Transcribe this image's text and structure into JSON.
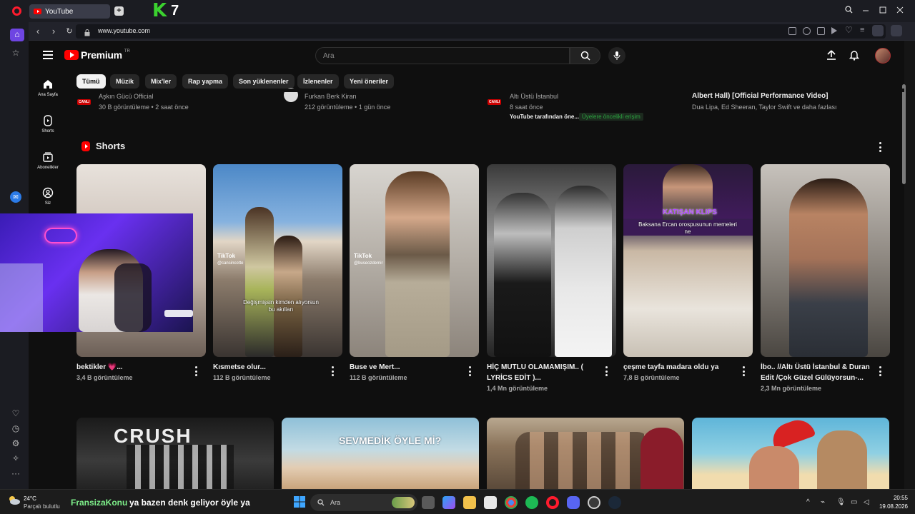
{
  "browser": {
    "tab_title": "YouTube",
    "new_tab": "+",
    "overlay_k": "K",
    "overlay_7": "7",
    "url": "www.youtube.com"
  },
  "youtube": {
    "logo_text": "Premium",
    "logo_region": "TR",
    "search_placeholder": "Ara",
    "chips": [
      "Tümü",
      "Müzik",
      "Mix'ler",
      "Rap yapma",
      "Son yüklenenler",
      "İzlenenler",
      "Yeni öneriler"
    ],
    "guide": [
      {
        "label": "Ana Sayfa",
        "icon": "home-icon"
      },
      {
        "label": "Shorts",
        "icon": "shorts-icon"
      },
      {
        "label": "Abonelikler",
        "icon": "subscriptions-icon"
      },
      {
        "label": "Siz",
        "icon": "you-icon"
      }
    ],
    "top_row": [
      {
        "channel": "Aşkın Gücü Official",
        "meta": "30 B görüntüleme • 2 saat önce",
        "live_badge": "CANLI"
      },
      {
        "channel": "Furkan Berk Kiran",
        "meta": "212 görüntüleme • 1 gün önce"
      },
      {
        "channel": "Altı Üstü İstanbul",
        "meta": "8 saat önce",
        "extra": "YouTube tarafından öne...",
        "badge": "Üyelere öncelikli erişim",
        "live_badge": "CANLI"
      },
      {
        "title": "Albert Hall) [Official Performance Video]",
        "meta": "Dua Lipa, Ed Sheeran, Taylor Swift ve daha fazlası"
      }
    ],
    "shorts_title": "Shorts",
    "shorts": [
      {
        "title": "bektikler 💗...",
        "views": "3,4 B görüntüleme"
      },
      {
        "title": "Kısmetse olur...",
        "views": "112 B görüntüleme",
        "caption": "Değişmişsin kimden alıyorsun bu akılları",
        "tiktok": "TikTok",
        "handle": "@cansincotte"
      },
      {
        "title": "Buse ve Mert...",
        "views": "112 B görüntüleme",
        "tiktok": "TikTok",
        "handle": "@buseozdemir"
      },
      {
        "title": "HİÇ MUTLU OLAMAMIŞIM.. ( LYRİCS EDİT )...",
        "views": "1,4 Mn görüntüleme"
      },
      {
        "title": "çeşme tayfa madara oldu ya",
        "views": "7,8 B görüntüleme",
        "overlay_top": "KATIŞAN KLIPS",
        "caption": "Baksana Ercan orospusunun memeleri ne"
      },
      {
        "title": "İbo.. //Altı Üstü İstanbul & Duran Edit /Çok Güzel Gülüyorsun-...",
        "views": "2,3 Mn görüntüleme"
      }
    ],
    "bottom_row": [
      {
        "overlay": "CRUSH"
      },
      {
        "overlay": "SEVMEDİK ÖYLE Mİ?"
      },
      {
        "overlay": ""
      },
      {
        "overlay": ""
      }
    ]
  },
  "taskbar": {
    "weather_temp": "24°C",
    "weather_desc": "Parçalı bulutlu",
    "ticker_name": "FransizaKonu",
    "ticker_msg": "ya bazen denk geliyor öyle ya",
    "search_placeholder": "Ara",
    "time": "20:55",
    "date": "19.08.2026"
  },
  "colors": {
    "yt_red": "#ff0000",
    "opera_red": "#ff1b2d",
    "ticker_green": "#7ef08a",
    "accent_purple": "#6e45e2"
  }
}
